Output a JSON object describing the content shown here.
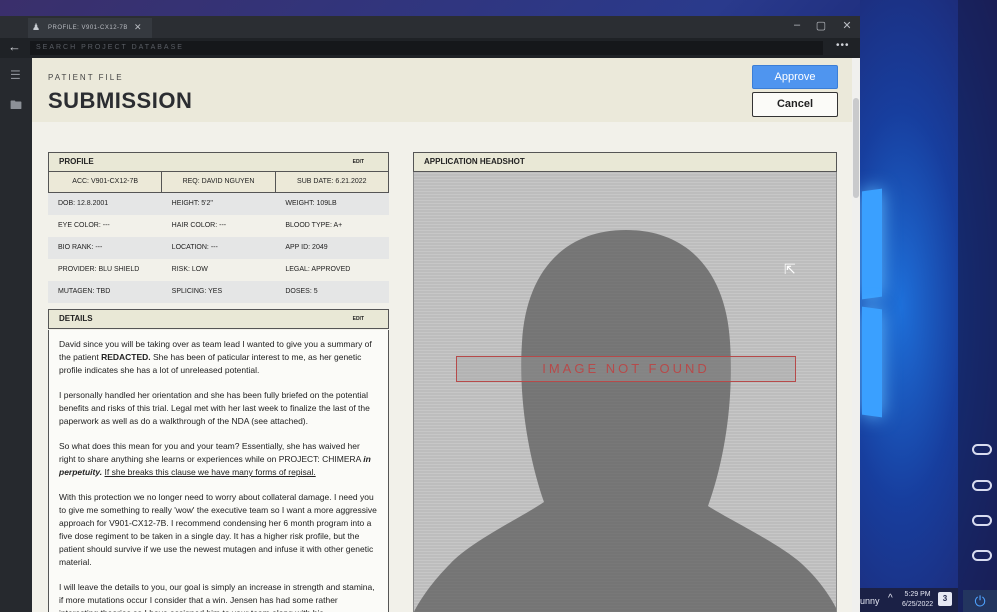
{
  "tab": {
    "title": "PROFILE: V901-CX12-7B",
    "icon": "user-icon"
  },
  "window_controls": {
    "minimize": "–",
    "maximize": "▢",
    "close": "✕"
  },
  "address": {
    "back_icon": "back-arrow-icon",
    "placeholder": "SEARCH PROJECT DATABASE",
    "more": "•••"
  },
  "sidebar": {
    "items": [
      {
        "icon": "menu-icon"
      },
      {
        "icon": "folder-icon"
      }
    ]
  },
  "header": {
    "eyebrow": "PATIENT FILE",
    "title": "SUBMISSION"
  },
  "actions": {
    "approve": "Approve",
    "cancel": "Cancel",
    "approve_color": "#4f95ef"
  },
  "profile": {
    "heading": "PROFILE",
    "edit": "EDIT",
    "acc": "ACC: V901-CX12-7B",
    "req": "REQ: DAVID NGUYEN",
    "sub_date": "SUB DATE: 6.21.2022",
    "rows": [
      [
        "DOB: 12.8.2001",
        "HEIGHT: 5'2\"",
        "WEIGHT: 109LB"
      ],
      [
        "EYE COLOR: ---",
        "HAIR COLOR: ---",
        "BLOOD TYPE: A+"
      ],
      [
        "BIO RANK: ---",
        "LOCATION: ---",
        "APP ID: 2049"
      ],
      [
        "PROVIDER: BLU SHIELD",
        "RISK: LOW",
        "LEGAL: APPROVED"
      ],
      [
        "MUTAGEN: TBD",
        "SPLICING: YES",
        "DOSES: 5"
      ]
    ]
  },
  "details": {
    "heading": "DETAILS",
    "edit": "EDIT",
    "p1_a": "David since you will be taking over as team lead I wanted to give you a summary of the patient ",
    "p1_b": "REDACTED.",
    "p1_c": "  She has been of paticular interest to me, as her genetic profile indicates she has a lot of unreleased potential.",
    "p2": "I personally handled her orientation and she has been fully briefed on the potential benefits and risks of this trial.  Legal met with her last week to finalize the last of the paperwork as well as do a walkthrough of the NDA (see attached).",
    "p3_a": "So what does this mean for you and your team? Essentially, she has waived her right to share anything she learns or experiences while on PROJECT: CHIMERA ",
    "p3_b": "in perpetuity.",
    "p3_c": " ",
    "p3_d": "If she breaks this clause we have many forms of repisal.",
    "p4": "With this protection we no longer need to worry about collateral damage. I need you to give me something to really 'wow' the executive team so I want a more aggressive approach for V901-CX12-7B. I recommend condensing her 6 month program into a five dose regiment to be taken in a single day.  It has a higher risk profile, but the patient should survive if we use the newest mutagen and infuse it with other genetic material.",
    "p5": "I will leave the details to you, our goal is simply an increase in strength and stamina, if more mutations occur I consider that a win. Jensen has had some rather interesting theories so I have assigned him to your team along with his"
  },
  "headshot": {
    "heading": "APPLICATION HEADSHOT",
    "not_found": "IMAGE NOT FOUND",
    "error_color": "#b64a4a"
  },
  "taskbar": {
    "user": "unny",
    "chevron": "^",
    "time": "5:29 PM",
    "date": "6/25/2022",
    "notif": "3",
    "power_icon": "power-icon"
  }
}
